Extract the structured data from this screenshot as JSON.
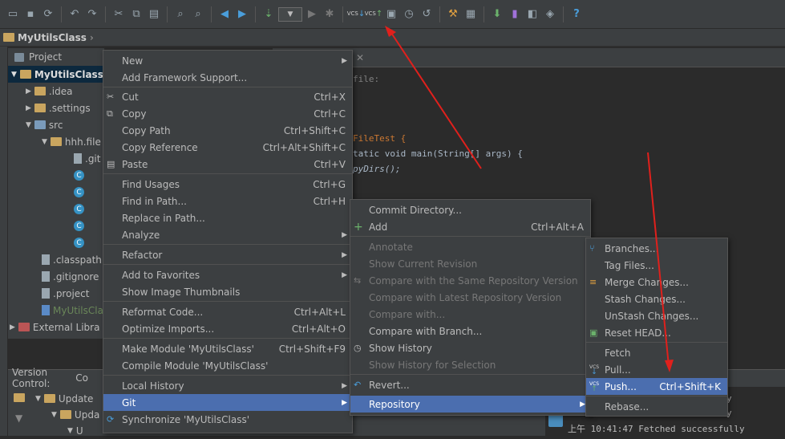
{
  "project_name": "MyUtilsClass",
  "project_panel": {
    "title": "Project",
    "tree": [
      ".idea",
      ".settings",
      "src",
      "hhh.file",
      ".git",
      ".classpath",
      ".gitignore",
      ".project",
      "MyUtilsCla",
      "External Libra"
    ]
  },
  "editor": {
    "lines": [
      "file:",
      "FileTest {",
      "tatic void main(String[] args) {",
      "pyDirs();"
    ]
  },
  "version_control": {
    "tab": "Version Control:",
    "tab2": "Co",
    "tree": [
      "Update",
      "Upda",
      "U"
    ],
    "log": [
      "y",
      "y",
      "上午 10:41:47 Fetched successfully"
    ]
  },
  "context_menu": [
    {
      "label": "New",
      "submenu": true
    },
    {
      "label": "Add Framework Support..."
    },
    {
      "label": "Cut",
      "shortcut": "Ctrl+X"
    },
    {
      "label": "Copy",
      "shortcut": "Ctrl+C"
    },
    {
      "label": "Copy Path",
      "shortcut": "Ctrl+Shift+C"
    },
    {
      "label": "Copy Reference",
      "shortcut": "Ctrl+Alt+Shift+C"
    },
    {
      "label": "Paste",
      "shortcut": "Ctrl+V"
    },
    {
      "label": "Find Usages",
      "shortcut": "Ctrl+G"
    },
    {
      "label": "Find in Path...",
      "shortcut": "Ctrl+H"
    },
    {
      "label": "Replace in Path..."
    },
    {
      "label": "Analyze",
      "submenu": true
    },
    {
      "label": "Refactor",
      "submenu": true
    },
    {
      "label": "Add to Favorites",
      "submenu": true
    },
    {
      "label": "Show Image Thumbnails"
    },
    {
      "label": "Reformat Code...",
      "shortcut": "Ctrl+Alt+L"
    },
    {
      "label": "Optimize Imports...",
      "shortcut": "Ctrl+Alt+O"
    },
    {
      "label": "Make Module 'MyUtilsClass'",
      "shortcut": "Ctrl+Shift+F9"
    },
    {
      "label": "Compile Module 'MyUtilsClass'"
    },
    {
      "label": "Local History",
      "submenu": true
    },
    {
      "label": "Git",
      "submenu": true
    },
    {
      "label": "Synchronize 'MyUtilsClass'"
    }
  ],
  "git_menu": [
    {
      "label": "Commit Directory..."
    },
    {
      "label": "Add",
      "shortcut": "Ctrl+Alt+A"
    },
    {
      "label": "Annotate"
    },
    {
      "label": "Show Current Revision"
    },
    {
      "label": "Compare with the Same Repository Version"
    },
    {
      "label": "Compare with Latest Repository Version"
    },
    {
      "label": "Compare with..."
    },
    {
      "label": "Compare with Branch..."
    },
    {
      "label": "Show History"
    },
    {
      "label": "Show History for Selection"
    },
    {
      "label": "Revert..."
    },
    {
      "label": "Repository",
      "submenu": true
    }
  ],
  "repo_menu": [
    {
      "label": "Branches..."
    },
    {
      "label": "Tag Files..."
    },
    {
      "label": "Merge Changes..."
    },
    {
      "label": "Stash Changes..."
    },
    {
      "label": "UnStash Changes..."
    },
    {
      "label": "Reset HEAD..."
    },
    {
      "label": "Fetch"
    },
    {
      "label": "Pull..."
    },
    {
      "label": "Push...",
      "shortcut": "Ctrl+Shift+K"
    },
    {
      "label": "Rebase..."
    }
  ],
  "colors": {
    "selection": "#4b6eaf",
    "annotation_arrow": "#e0201c",
    "panel": "#3c3f41"
  }
}
